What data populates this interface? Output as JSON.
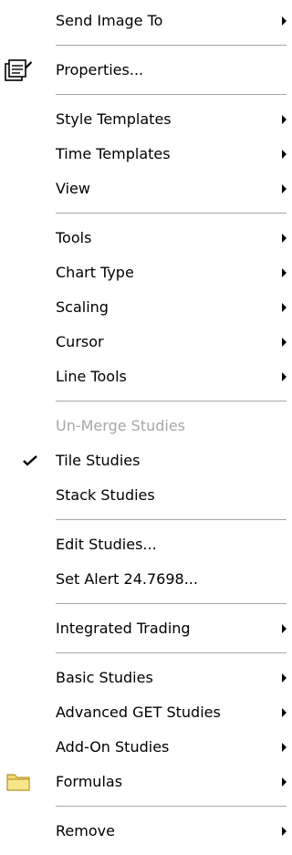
{
  "menu": {
    "items": [
      {
        "label": "Send Image To"
      },
      {
        "label": "Properties..."
      },
      {
        "label": "Style Templates"
      },
      {
        "label": "Time Templates"
      },
      {
        "label": "View"
      },
      {
        "label": "Tools"
      },
      {
        "label": "Chart Type"
      },
      {
        "label": "Scaling"
      },
      {
        "label": "Cursor"
      },
      {
        "label": "Line Tools"
      },
      {
        "label": "Un-Merge Studies"
      },
      {
        "label": "Tile Studies"
      },
      {
        "label": "Stack Studies"
      },
      {
        "label": "Edit Studies..."
      },
      {
        "label": "Set Alert 24.7698..."
      },
      {
        "label": "Integrated Trading"
      },
      {
        "label": "Basic Studies"
      },
      {
        "label": "Advanced GET Studies"
      },
      {
        "label": "Add-On Studies"
      },
      {
        "label": "Formulas"
      },
      {
        "label": "Remove"
      }
    ]
  },
  "icons": {
    "properties": "properties-icon",
    "formulas": "folder-icon",
    "submenu": "submenu-arrow-icon",
    "checked": "checkmark-icon"
  },
  "colors": {
    "text": "#000000",
    "disabled_text": "#a7a6aa",
    "separator": "#a7a6aa",
    "folder": "#f5d76e"
  }
}
